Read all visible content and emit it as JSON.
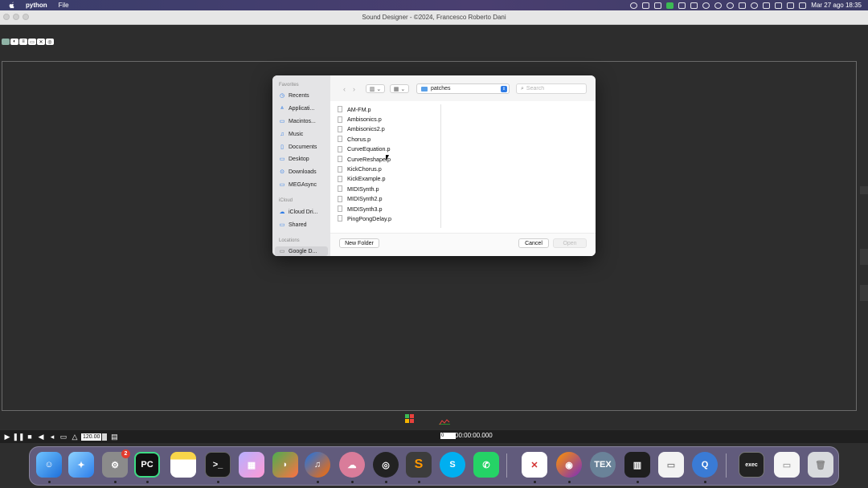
{
  "menubar": {
    "app_name": "python",
    "menu_file": "File",
    "date_time": "Mar 27 ago  18:35"
  },
  "window": {
    "title": "Sound Designer - ©2024, Francesco Roberto Dani"
  },
  "transport": {
    "tempo": "120.00",
    "position": "0",
    "time": "00:00:00.000"
  },
  "dock": {
    "calendar_badge": "2",
    "apps": [
      "finder",
      "safari",
      "system-settings",
      "pycharm",
      "notes",
      "terminal",
      "launchpad",
      "sourcetree",
      "audacity",
      "pd",
      "sonic-visualiser",
      "sublime-text",
      "skype",
      "whatsapp",
      "remote-desktop",
      "firefox",
      "texshop",
      "midi-keyboard",
      "document",
      "quicktime",
      "terminal-window",
      "document-2",
      "trash"
    ]
  },
  "dialog": {
    "sidebar": {
      "favorites_label": "Favorites",
      "favorites": [
        "Recents",
        "Applicati...",
        "Macintos...",
        "Music",
        "Documents",
        "Desktop",
        "Downloads",
        "MEGAsync"
      ],
      "icloud_label": "iCloud",
      "icloud": [
        "iCloud Dri...",
        "Shared"
      ],
      "locations_label": "Locations",
      "locations": [
        "Google D..."
      ]
    },
    "location": "patches",
    "search_placeholder": "Search",
    "files": [
      "AM-FM.p",
      "Ambisonics.p",
      "Ambisonics2.p",
      "Chorus.p",
      "CurveEquation.p",
      "CurveReshape.p",
      "KickChorus.p",
      "KickExample.p",
      "MIDISynth.p",
      "MIDISynth2.p",
      "MIDISynth3.p",
      "PingPongDelay.p"
    ],
    "buttons": {
      "new_folder": "New Folder",
      "cancel": "Cancel",
      "open": "Open"
    }
  },
  "colors": {
    "accent": "#2f7ce6",
    "app_background": "#2d2d2d",
    "dialog_sidebar": "#e4e4e6"
  }
}
